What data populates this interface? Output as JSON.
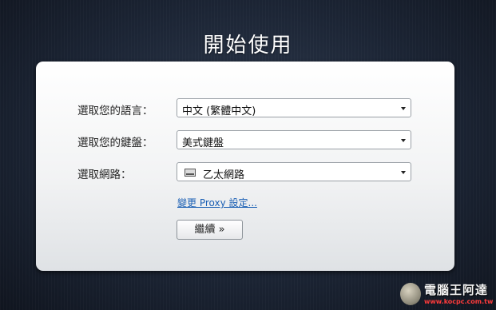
{
  "title": "開始使用",
  "form": {
    "language": {
      "label": "選取您的語言：",
      "value": "中文 (繁體中文)"
    },
    "keyboard": {
      "label": "選取您的鍵盤：",
      "value": "美式鍵盤"
    },
    "network": {
      "label": "選取網路：",
      "value": "乙太網路",
      "icon": "ethernet-icon"
    }
  },
  "proxy_link": "變更 Proxy 設定...",
  "continue_button": "繼續 »",
  "watermark": {
    "title": "電腦王阿達",
    "url": "www.kocpc.com.tw"
  },
  "colors": {
    "link": "#1a5fb4",
    "background": "#1c2535",
    "watermark_url": "#ff3b3b"
  }
}
